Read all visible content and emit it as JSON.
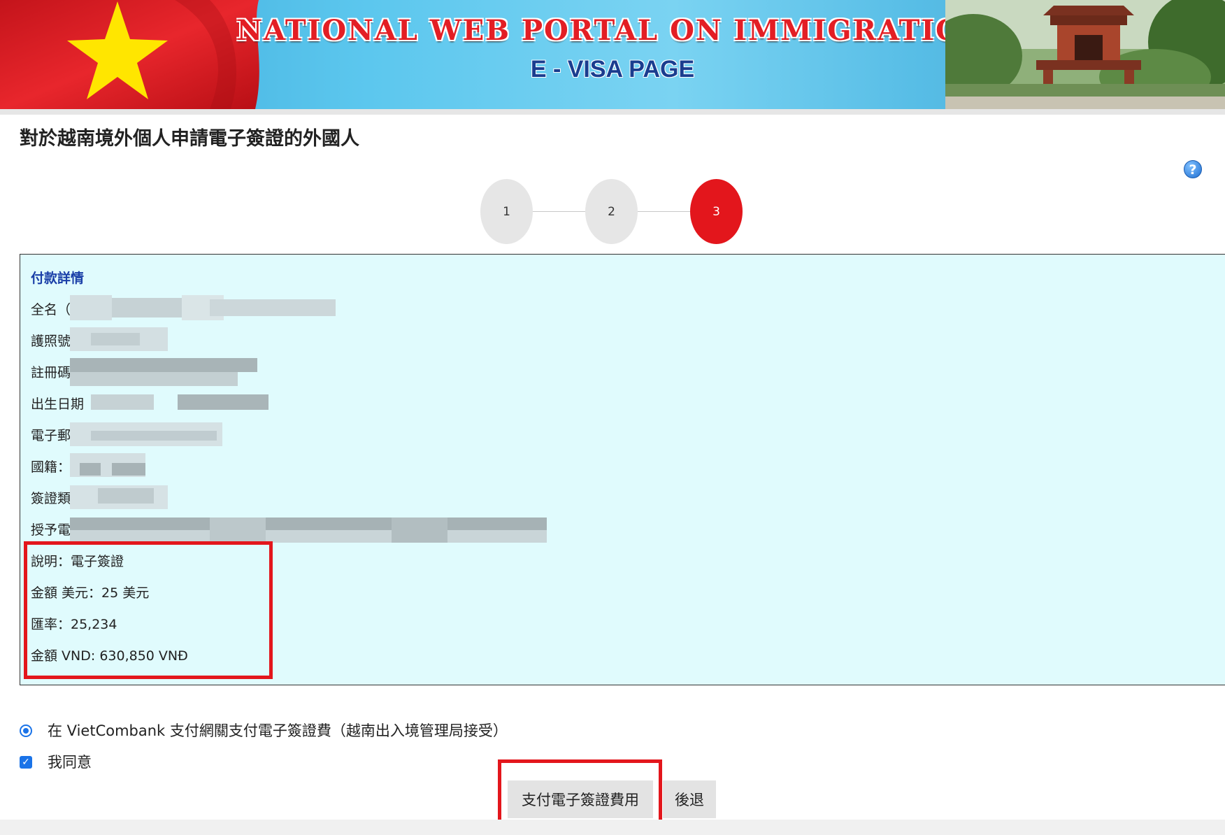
{
  "banner": {
    "title": "NATIONAL WEB PORTAL ON IMMIGRATION",
    "subtitle": "E - VISA PAGE"
  },
  "page_title": "對於越南境外個人申請電子簽證的外國人",
  "help_icon": {
    "glyph": "?",
    "icon": "help-icon"
  },
  "stepper": {
    "steps": [
      "1",
      "2",
      "3"
    ],
    "active_step": 3,
    "active_color": "#e3161c"
  },
  "payment": {
    "heading": "付款詳情",
    "redacted_rows": [
      {
        "label": "全名（名"
      },
      {
        "label": "護照號碼"
      },
      {
        "label": "註冊碼"
      },
      {
        "label": "出生日期"
      },
      {
        "label": "電子郵件"
      },
      {
        "label": "國籍：台"
      },
      {
        "label": "簽證類型"
      },
      {
        "label": "授予電子"
      }
    ],
    "description": "說明：電子簽證",
    "amount_usd": "金額 美元：25 美元",
    "exchange_rate": "匯率：25,234",
    "amount_vnd": "金額 VND: 630,850 VNĐ"
  },
  "options": {
    "payment_gateway": "在 VietCombank 支付網關支付電子簽證費（越南出入境管理局接受）",
    "payment_gateway_selected": true,
    "agree": "我同意",
    "agree_checked": true
  },
  "buttons": {
    "pay": "支付電子簽證費用",
    "back": "後退"
  },
  "colors": {
    "panel_bg": "#e0fbfd",
    "heading": "#1a3fa8",
    "highlight": "#e3161c"
  }
}
